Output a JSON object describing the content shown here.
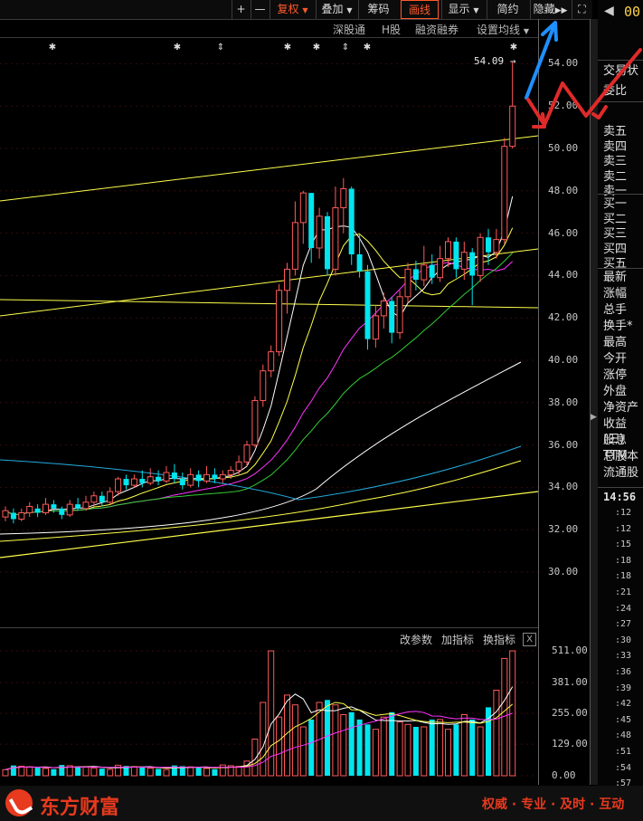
{
  "toolbar": {
    "plus": "+",
    "minus": "—",
    "fuquan": "复权",
    "diejia": "叠加",
    "chouma": "筹码",
    "huaxian": "画线",
    "xianshi": "显示",
    "jianyue": "简约",
    "yincang": "隐藏",
    "fullscreen": "⛶"
  },
  "subtoolbar": {
    "shengutong": "深股通",
    "hgu": "H股",
    "rongzi": "融资融券",
    "junxian": "设置均线"
  },
  "price_axis": [
    "54.00",
    "52.00",
    "50.00",
    "48.00",
    "46.00",
    "44.00",
    "42.00",
    "40.00",
    "38.00",
    "36.00",
    "34.00",
    "32.00",
    "30.00"
  ],
  "high_label": "54.09",
  "volume_axis": [
    "511.00",
    "381.00",
    "255.00",
    "129.00",
    "0.00"
  ],
  "indicator_bar": {
    "gaicanshu": "改参数",
    "jiazhibiao": "加指标",
    "huanzhibiao": "换指标",
    "close": "X"
  },
  "right_panel": {
    "top_code": "00",
    "rows1": [
      "交易状",
      "委比"
    ],
    "sell": [
      "卖五",
      "卖四",
      "卖三",
      "卖二",
      "卖一"
    ],
    "buy": [
      "买一",
      "买二",
      "买三",
      "买四",
      "买五"
    ],
    "stats": [
      "最新",
      "涨幅",
      "总手",
      "换手*",
      "最高",
      "今开",
      "涨停",
      "外盘",
      "净资产",
      "收益(三)",
      "股息TTM",
      "总股本",
      "流通股"
    ],
    "time_header": "14:56",
    "times": [
      ":12",
      ":12",
      ":15",
      ":18",
      ":18",
      ":21",
      ":24",
      ":27",
      ":30",
      ":33",
      ":36",
      ":39",
      ":42",
      ":45",
      ":48",
      ":51",
      ":54",
      ":57"
    ]
  },
  "footer": {
    "brand": "东方财富",
    "slogan": "权威 · 专业 · 及时 · 互动"
  },
  "colors": {
    "up": "#ff5a5a",
    "down": "#00e5ee",
    "ma_yellow": "#ffff4c",
    "ma_white": "#ffffff",
    "ma_magenta": "#ff33ff",
    "ma_green": "#33cc33",
    "ma_cyan": "#22aadd"
  }
}
